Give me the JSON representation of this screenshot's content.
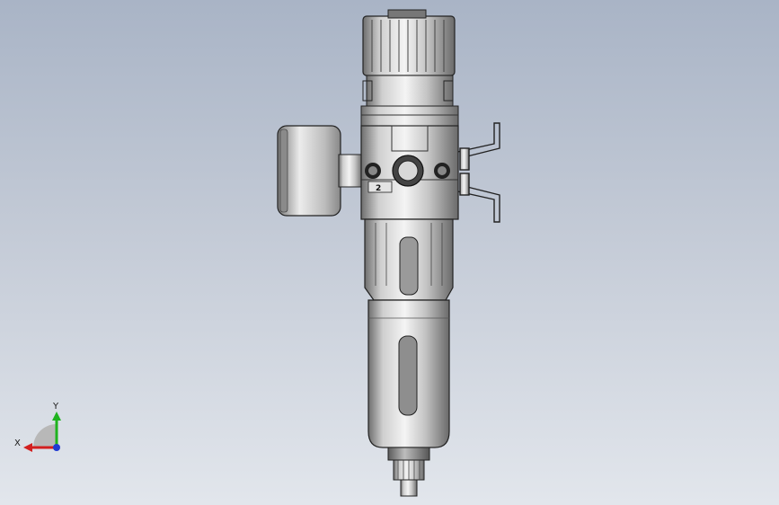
{
  "viewport": {
    "background_top": "#a9b4c6",
    "background_bottom": "#e2e6ec"
  },
  "model": {
    "port_marking": "2",
    "part_name": "filter-regulator-with-gauge"
  },
  "triad": {
    "x_label": "X",
    "y_label": "Y",
    "x_color": "#d21f1f",
    "y_color": "#1fb31f",
    "z_color": "#1f3ad2"
  }
}
